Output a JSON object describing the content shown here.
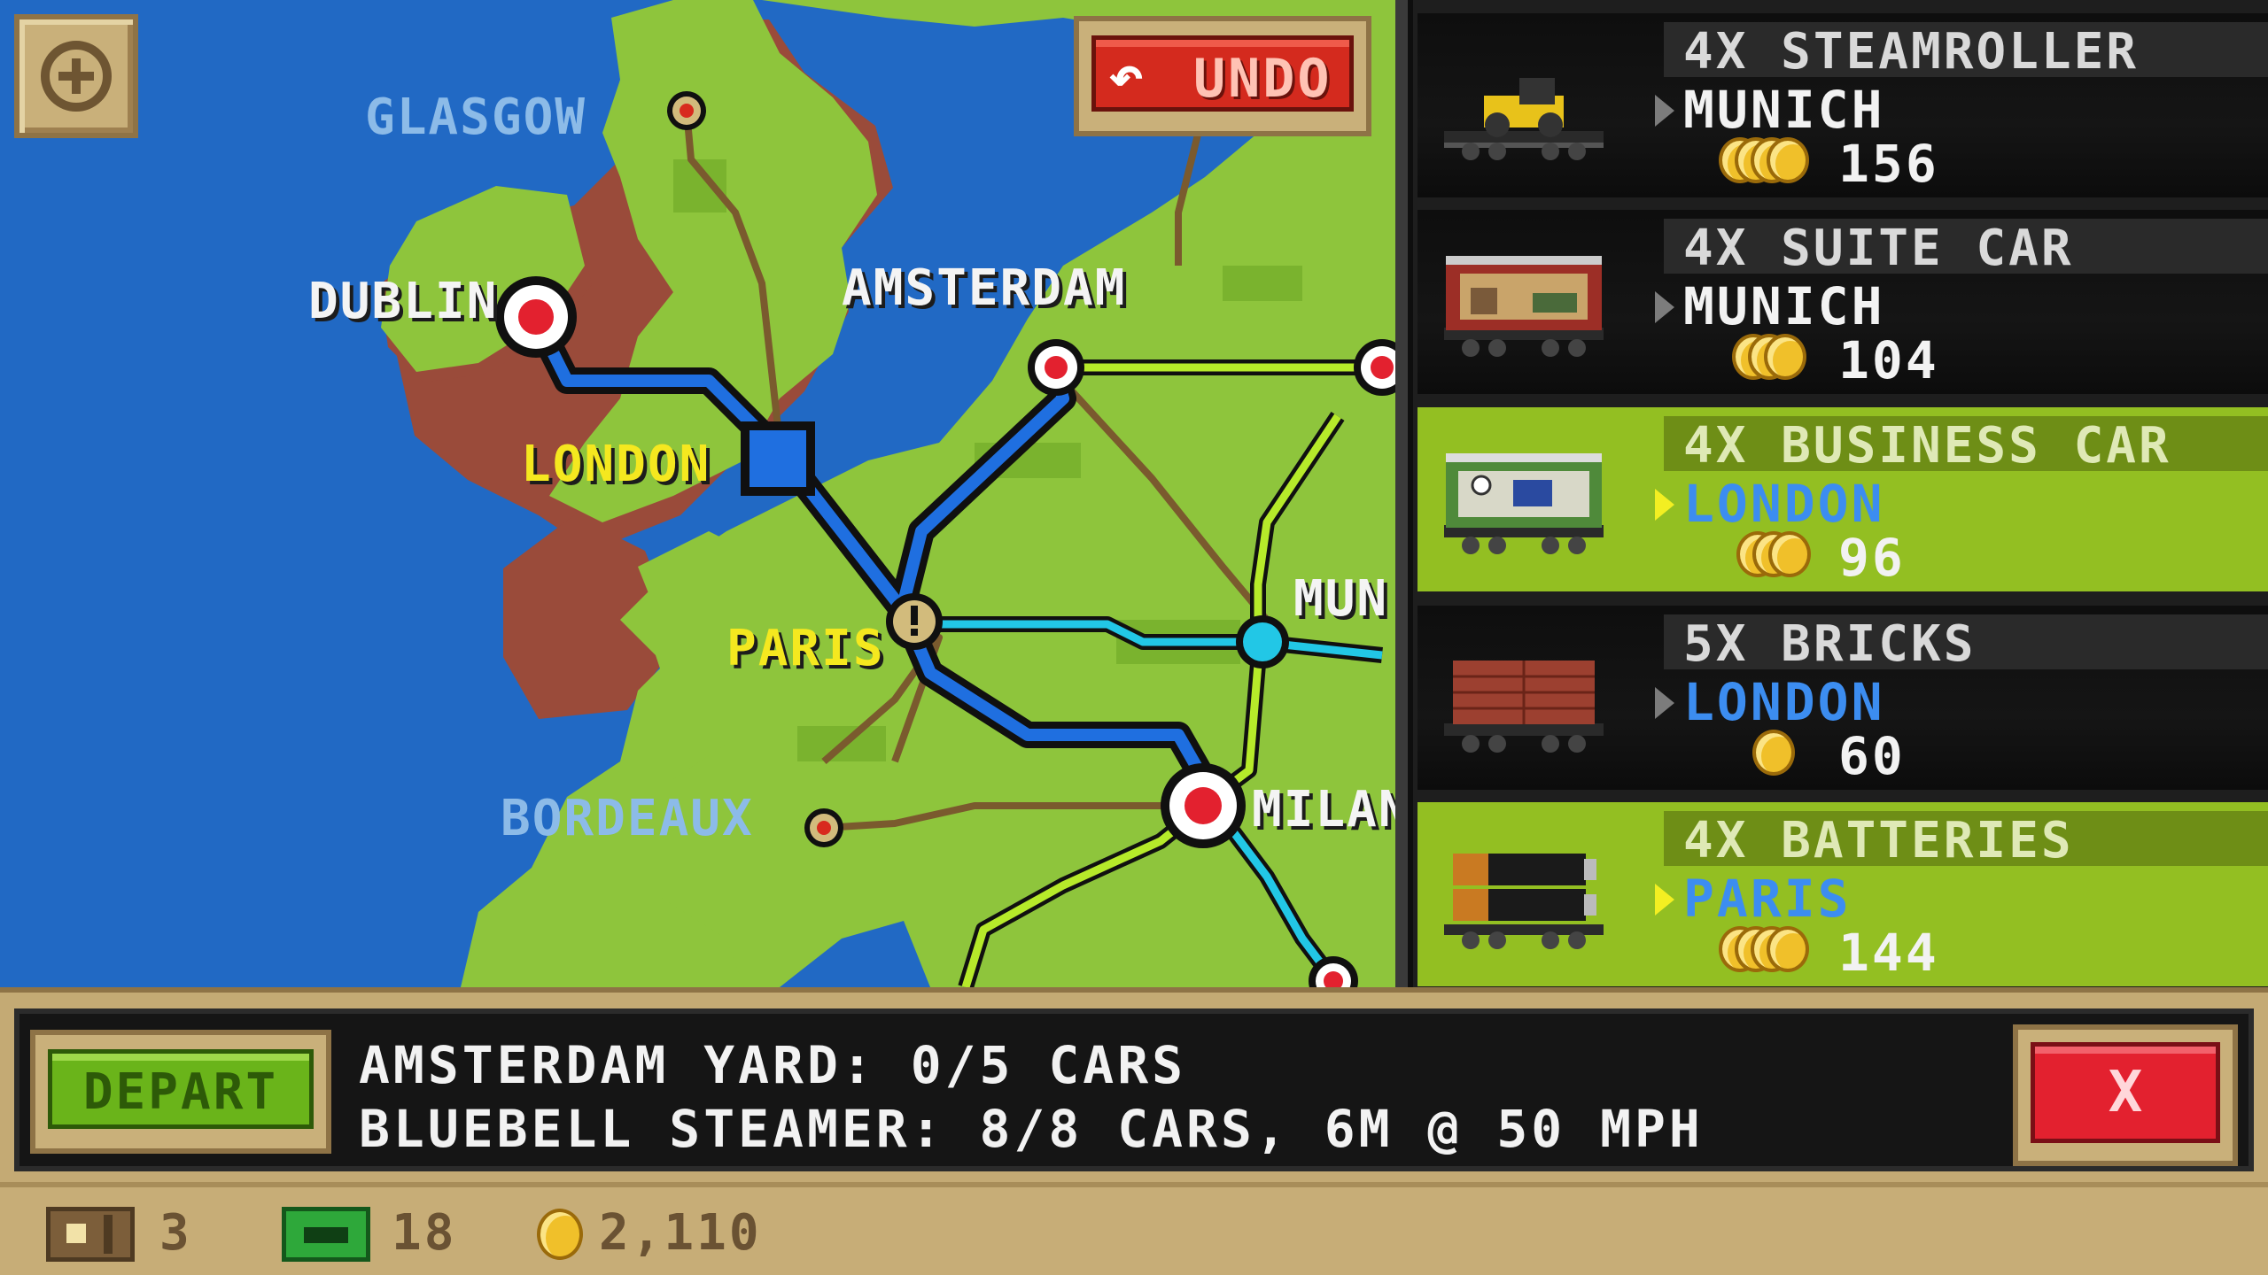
{
  "map": {
    "cities": {
      "glasgow": "GLASGOW",
      "dublin": "DUBLIN",
      "amsterdam": "AMSTERDAM",
      "london": "LONDON",
      "paris": "PARIS",
      "munich": "MUN",
      "bordeaux": "BORDEAUX",
      "milan": "MILAN"
    },
    "undo_label": "UNDO"
  },
  "cargo": [
    {
      "title": "4X STEAMROLLER",
      "destination": "MUNICH",
      "price": "156",
      "selected": false,
      "dest_color": "white",
      "thumb": "steamroller-car"
    },
    {
      "title": "4X SUITE CAR",
      "destination": "MUNICH",
      "price": "104",
      "selected": false,
      "dest_color": "white",
      "thumb": "suite-car"
    },
    {
      "title": "4X BUSINESS CAR",
      "destination": "LONDON",
      "price": "96",
      "selected": true,
      "dest_color": "blue",
      "thumb": "business-car"
    },
    {
      "title": "5X BRICKS",
      "destination": "LONDON",
      "price": "60",
      "selected": false,
      "dest_color": "blue",
      "thumb": "bricks-car"
    },
    {
      "title": "4X BATTERIES",
      "destination": "PARIS",
      "price": "144",
      "selected": true,
      "dest_color": "blue",
      "thumb": "batteries-car"
    }
  ],
  "dialog": {
    "depart_label": "DEPART",
    "line1": "AMSTERDAM YARD: 0/5 CARS",
    "line2": "BLUEBELL STEAMER: 8/8 CARS, 6M @ 50 MPH",
    "close_label": "X"
  },
  "status": {
    "trains": "3",
    "bux": "18",
    "coins": "2,110"
  },
  "colors": {
    "sea": "#2169c4",
    "land": "#86c43a",
    "selected_row": "#93bf22",
    "route_blue": "#1f6fe0",
    "route_cyan": "#22c7e6",
    "route_green": "#b6ea2a"
  }
}
